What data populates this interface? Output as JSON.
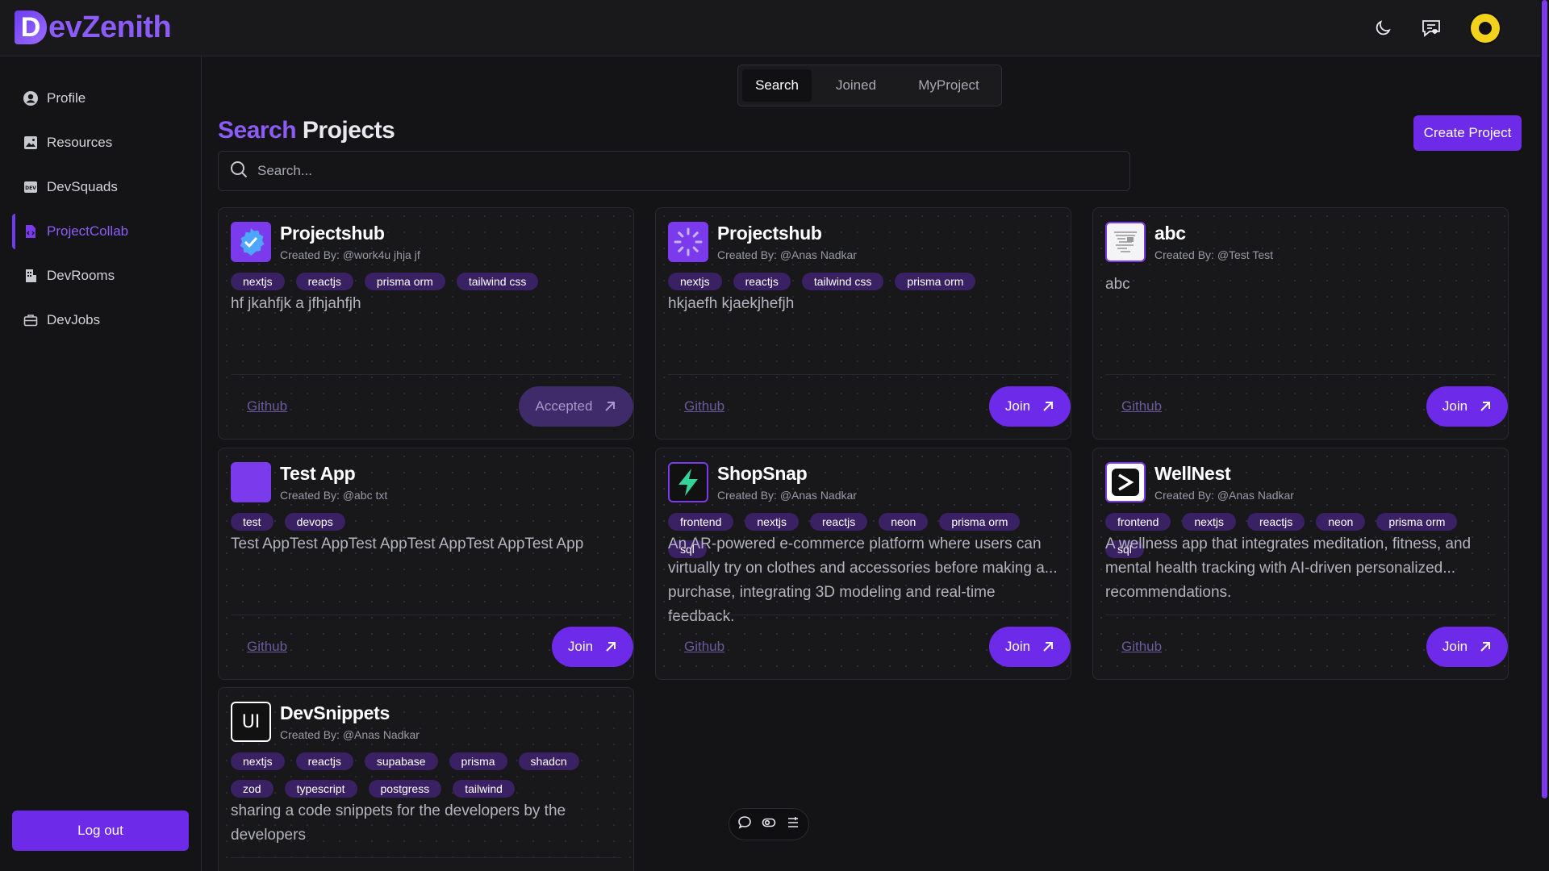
{
  "app": {
    "logo_letter": "D",
    "logo_text": "evZenith",
    "colors": {
      "accent": "#7c3aed",
      "accent_light": "#8b5cf6",
      "tag_bg": "#3a2163",
      "bg": "#141416"
    }
  },
  "header": {
    "icons": [
      "moon-icon",
      "message-heart-icon",
      "avatar"
    ]
  },
  "sidebar": {
    "items": [
      {
        "label": "Profile",
        "icon": "user-circle-icon",
        "active": false
      },
      {
        "label": "Resources",
        "icon": "image-icon",
        "active": false
      },
      {
        "label": "DevSquads",
        "icon": "dev-badge-icon",
        "active": false
      },
      {
        "label": "ProjectCollab",
        "icon": "code-file-icon",
        "active": true
      },
      {
        "label": "DevRooms",
        "icon": "building-icon",
        "active": false
      },
      {
        "label": "DevJobs",
        "icon": "briefcase-icon",
        "active": false
      }
    ],
    "logout_label": "Log out"
  },
  "main": {
    "tabs": [
      {
        "label": "Search",
        "active": true
      },
      {
        "label": "Joined",
        "active": false
      },
      {
        "label": "MyProject",
        "active": false
      }
    ],
    "title_accent": "Search",
    "title_rest": "Projects",
    "create_button": "Create Project",
    "search_placeholder": "Search..."
  },
  "projects": [
    {
      "title": "Projectshub",
      "creator": "Created By: @work4u jhja jf",
      "tags": [
        "nextjs",
        "reactjs",
        "prisma orm",
        "tailwind css"
      ],
      "description": "hf jkahfjk a jfhjahfjh",
      "github": "Github",
      "action": "Accepted",
      "logo": "verified-badge-icon"
    },
    {
      "title": "Projectshub",
      "creator": "Created By: @Anas Nadkar",
      "tags": [
        "nextjs",
        "reactjs",
        "tailwind css",
        "prisma orm"
      ],
      "description": "hkjaefh kjaekjhefjh",
      "github": "Github",
      "action": "Join",
      "logo": "spinner-icon"
    },
    {
      "title": "abc",
      "creator": "Created By: @Test Test",
      "tags": [],
      "description": "abc",
      "github": "Github",
      "action": "Join",
      "logo": "document-thumbnail-icon"
    },
    {
      "title": "Test App",
      "creator": "Created By: @abc txt",
      "tags": [
        "test",
        "devops"
      ],
      "description": "Test AppTest AppTest AppTest AppTest AppTest App",
      "github": "Github",
      "action": "Join",
      "logo": "purple-square-icon"
    },
    {
      "title": "ShopSnap",
      "creator": "Created By: @Anas Nadkar",
      "tags": [
        "frontend",
        "nextjs",
        "reactjs",
        "neon",
        "prisma orm",
        "sql"
      ],
      "description": "An AR-powered e-commerce platform where users can virtually try on clothes and accessories before making a... purchase, integrating 3D modeling and real-time feedback.",
      "github": "Github",
      "action": "Join",
      "logo": "lightning-icon"
    },
    {
      "title": "WellNest",
      "creator": "Created By: @Anas Nadkar",
      "tags": [
        "frontend",
        "nextjs",
        "reactjs",
        "neon",
        "prisma orm",
        "sql"
      ],
      "description": "A wellness app that integrates meditation, fitness, and mental health tracking with AI-driven personalized... recommendations.",
      "github": "Github",
      "action": "Join",
      "logo": "terminal-prompt-icon"
    },
    {
      "title": "DevSnippets",
      "creator": "Created By: @Anas Nadkar",
      "tags": [
        "nextjs",
        "reactjs",
        "supabase",
        "prisma",
        "shadcn",
        "zod",
        "typescript",
        "postgress",
        "tailwind"
      ],
      "description": "sharing a code snippets for the developers by the developers",
      "github": "",
      "action": "",
      "logo": "ui-text-icon",
      "logo_text": "UI"
    }
  ],
  "floatbar": {
    "icons": [
      "chat-bubble-icon",
      "toggle-icon",
      "list-icon"
    ]
  }
}
